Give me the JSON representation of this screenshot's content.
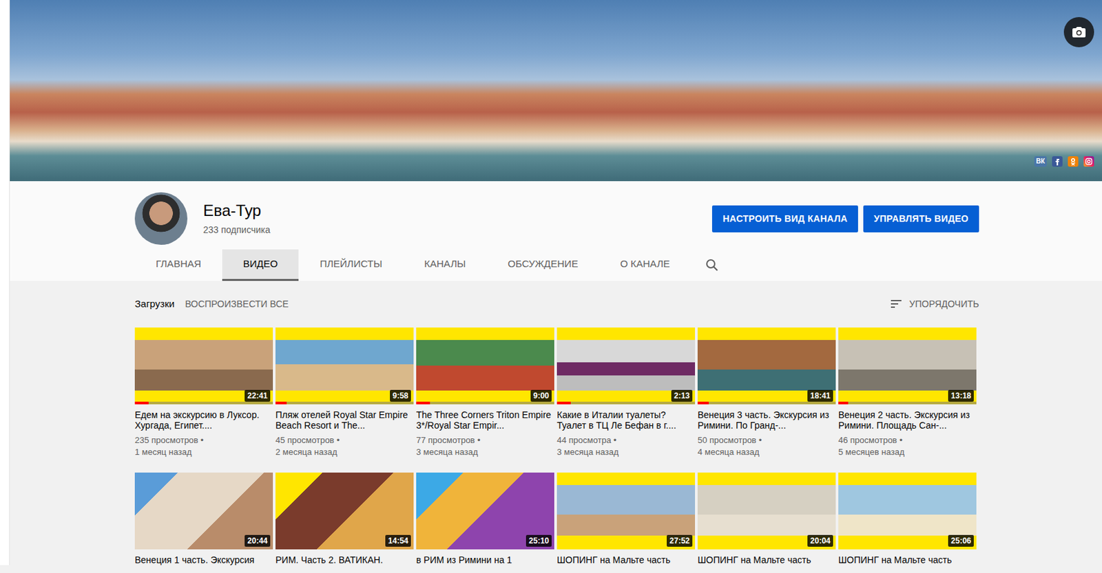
{
  "banner": {
    "social": [
      {
        "kind": "vk",
        "label": "ВК"
      },
      {
        "kind": "facebook"
      },
      {
        "kind": "ok"
      },
      {
        "kind": "instagram"
      }
    ]
  },
  "channel": {
    "name": "Ева-Тур",
    "subscribers": "233 подписчика"
  },
  "buttons": [
    "НАСТРОИТЬ ВИД КАНАЛА",
    "УПРАВЛЯТЬ ВИДЕО"
  ],
  "tabs": [
    {
      "label": "ГЛАВНАЯ",
      "selected": false
    },
    {
      "label": "ВИДЕО",
      "selected": true
    },
    {
      "label": "ПЛЕЙЛИСТЫ",
      "selected": false
    },
    {
      "label": "КАНАЛЫ",
      "selected": false
    },
    {
      "label": "ОБСУЖДЕНИЕ",
      "selected": false
    },
    {
      "label": "О КАНАЛЕ",
      "selected": false
    }
  ],
  "section": {
    "title": "Загрузки",
    "play_all": "ВОСПРОИЗВЕСТИ ВСЕ",
    "sort": "УПОРЯДОЧИТЬ"
  },
  "videos": [
    {
      "title": "Едем на экскурсию в Луксор. Хургада, Египет....",
      "views": "235 просмотров •",
      "age": "1 месяц назад",
      "duration": "22:41",
      "level": 0.1
    },
    {
      "title": "Пляж отелей Royal Star Empire Beach Resort и The...",
      "views": "45 просмотров •",
      "age": "2 месяца назад",
      "duration": "9:58",
      "level": 0.08
    },
    {
      "title": "The Three Corners Triton Empire 3*/Royal Star Empir...",
      "views": "77 просмотров •",
      "age": "3 месяца назад",
      "duration": "9:00",
      "level": 0.1
    },
    {
      "title": "Какие в Италии туалеты? Туалет в ТЦ Ле Бефан в г....",
      "views": "44 просмотра •",
      "age": "3 месяца назад",
      "duration": "2:13",
      "level": 0.1
    },
    {
      "title": "Венеция 3 часть. Экскурсия из Римини. По Гранд-...",
      "views": "50 просмотров •",
      "age": "4 месяца назад",
      "duration": "18:41",
      "level": 0.08
    },
    {
      "title": "Венеция 2 часть. Экскурсия из Римини. Площадь Сан-...",
      "views": "46 просмотров •",
      "age": "5 месяцев назад",
      "duration": "13:18",
      "level": 0.07
    },
    {
      "title": "Венеция 1 часть. Экскурсия",
      "duration": "20:44",
      "level": 0
    },
    {
      "title": "РИМ. Часть 2. ВАТИКАН.",
      "duration": "14:54",
      "level": 0
    },
    {
      "title": "в РИМ из Римини на 1",
      "duration": "25:10",
      "level": 0
    },
    {
      "title": "ШОПИНГ на Мальте часть",
      "duration": "27:52",
      "level": 0
    },
    {
      "title": "ШОПИНГ на Мальте часть",
      "duration": "20:04",
      "level": 0
    },
    {
      "title": "ШОПИНГ на Мальте часть",
      "duration": "25:06",
      "level": 0
    }
  ]
}
